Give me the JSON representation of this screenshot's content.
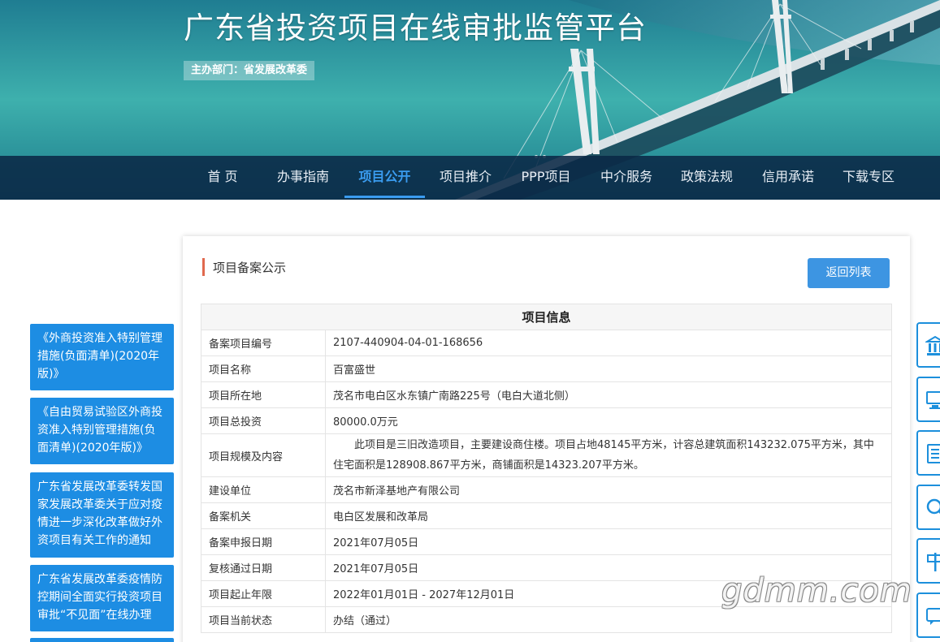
{
  "header": {
    "title": "广东省投资项目在线审批监管平台",
    "sponsor": "主办部门：省发展改革委"
  },
  "nav": {
    "items": [
      {
        "label": "首 页"
      },
      {
        "label": "办事指南"
      },
      {
        "label": "项目公开",
        "active": true
      },
      {
        "label": "项目推介"
      },
      {
        "label": "PPP项目"
      },
      {
        "label": "中介服务"
      },
      {
        "label": "政策法规"
      },
      {
        "label": "信用承诺"
      },
      {
        "label": "下载专区"
      }
    ]
  },
  "sidebar": {
    "links": [
      {
        "label": "《外商投资准入特别管理措施(负面清单)(2020年版)》"
      },
      {
        "label": "《自由贸易试验区外商投资准入特别管理措施(负面清单)(2020年版)》"
      },
      {
        "label": "广东省发展改革委转发国家发展改革委关于应对疫情进一步深化改革做好外资项目有关工作的通知"
      },
      {
        "label": "广东省发展改革委疫情防控期间全面实行投资项目审批“不见面”在线办理"
      }
    ]
  },
  "main": {
    "section_title": "项目备案公示",
    "back_button": "返回列表",
    "table_title": "项目信息",
    "rows": [
      {
        "label": "备案项目编号",
        "value": "2107-440904-04-01-168656"
      },
      {
        "label": "项目名称",
        "value": "百富盛世"
      },
      {
        "label": "项目所在地",
        "value": "茂名市电白区水东镇广南路225号（电白大道北侧）"
      },
      {
        "label": "项目总投资",
        "value": "80000.0万元"
      },
      {
        "label": "项目规模及内容",
        "value": "此项目是三旧改造项目，主要建设商住楼。项目占地48145平方米，计容总建筑面积143232.075平方米，其中住宅面积是128908.867平方米，商铺面积是14323.207平方米。"
      },
      {
        "label": "建设单位",
        "value": "茂名市新泽基地产有限公司"
      },
      {
        "label": "备案机关",
        "value": "电白区发展和改革局"
      },
      {
        "label": "备案申报日期",
        "value": "2021年07月05日"
      },
      {
        "label": "复核通过日期",
        "value": "2021年07月05日"
      },
      {
        "label": "项目起止年限",
        "value": "2022年01月01日 - 2027年12月01日"
      },
      {
        "label": "项目当前状态",
        "value": "办结（通过）"
      }
    ]
  },
  "float_buttons": [
    {
      "icon": "building-icon"
    },
    {
      "icon": "computer-icon"
    },
    {
      "icon": "document-icon"
    },
    {
      "icon": "search-icon"
    },
    {
      "icon": "signpost-icon"
    },
    {
      "icon": "chat-icon"
    }
  ],
  "watermark": "gdmm.com",
  "colors": {
    "accent": "#3a9cf0",
    "sidebar_blue": "#1d8de3",
    "nav_bg": "#0a2846",
    "title_bar": "#e0694e"
  }
}
